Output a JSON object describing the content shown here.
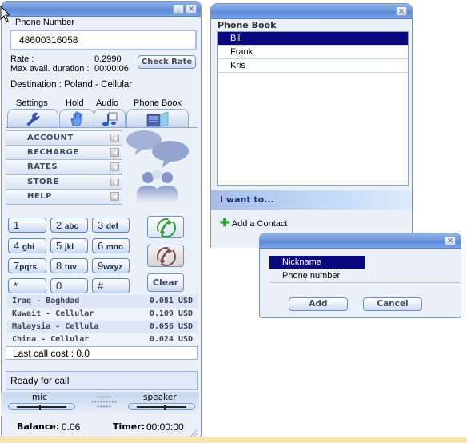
{
  "main_window": {
    "phone_number_label": "Phone Number",
    "phone_number_value": "48600316058",
    "rate_label": "Rate :",
    "rate_value": "0.2990",
    "max_duration_label": "Max avail. duration :",
    "max_duration_value": "00:00:06",
    "check_rate_button": "Check Rate",
    "destination": "Destination : Poland - Cellular",
    "tabs": [
      {
        "label": "Settings",
        "icon": "wrench-icon"
      },
      {
        "label": "Hold",
        "icon": "hand-icon"
      },
      {
        "label": "Audio",
        "icon": "music-note-icon"
      },
      {
        "label": "Phone Book",
        "icon": "book-icon"
      }
    ],
    "menu": [
      {
        "label": "ACCOUNT"
      },
      {
        "label": "RECHARGE"
      },
      {
        "label": "RATES"
      },
      {
        "label": "STORE"
      },
      {
        "label": "HELP"
      }
    ],
    "keypad": [
      {
        "digit": "1",
        "letters": ""
      },
      {
        "digit": "2",
        "letters": "abc"
      },
      {
        "digit": "3",
        "letters": "def"
      },
      {
        "digit": "4",
        "letters": "ghi"
      },
      {
        "digit": "5",
        "letters": "jkl"
      },
      {
        "digit": "6",
        "letters": "mno"
      },
      {
        "digit": "7",
        "letters": "pqrs"
      },
      {
        "digit": "8",
        "letters": "tuv"
      },
      {
        "digit": "9",
        "letters": "wxyz"
      },
      {
        "digit": "*",
        "letters": ""
      },
      {
        "digit": "0",
        "letters": ""
      },
      {
        "digit": "#",
        "letters": ""
      }
    ],
    "clear_button": "Clear",
    "recent_rates": [
      {
        "destination": "Iraq - Baghdad",
        "price": "0.081 USD"
      },
      {
        "destination": "Kuwait - Cellular",
        "price": "0.109 USD"
      },
      {
        "destination": "Malaysia - Cellula",
        "price": "0.056 USD"
      },
      {
        "destination": "China - Cellular",
        "price": "0.024 USD"
      }
    ],
    "last_call_cost": "Last call cost : 0.0",
    "status": "Ready for call",
    "mic_label": "mic",
    "speaker_label": "speaker",
    "mic_level": 0.45,
    "speaker_level": 0.55,
    "balance_label": "Balance:",
    "balance_value": "0.06",
    "timer_label": "Timer:",
    "timer_value": "00:00:00",
    "colors": {
      "call_green": "#2e9b2e",
      "hangup_brown": "#7a4a4a",
      "selection": "#0a0a7e"
    }
  },
  "phone_book_window": {
    "title": "Phone Book",
    "contacts": [
      {
        "name": "Bill",
        "selected": true
      },
      {
        "name": "Frank",
        "selected": false
      },
      {
        "name": "Kris",
        "selected": false
      }
    ],
    "i_want_to": "I want to...",
    "add_contact": "Add a Contact"
  },
  "add_contact_dialog": {
    "fields": [
      {
        "label": "Nickname",
        "value": "",
        "selected": true
      },
      {
        "label": "Phone number",
        "value": "",
        "selected": false
      }
    ],
    "add_button": "Add",
    "cancel_button": "Cancel"
  }
}
